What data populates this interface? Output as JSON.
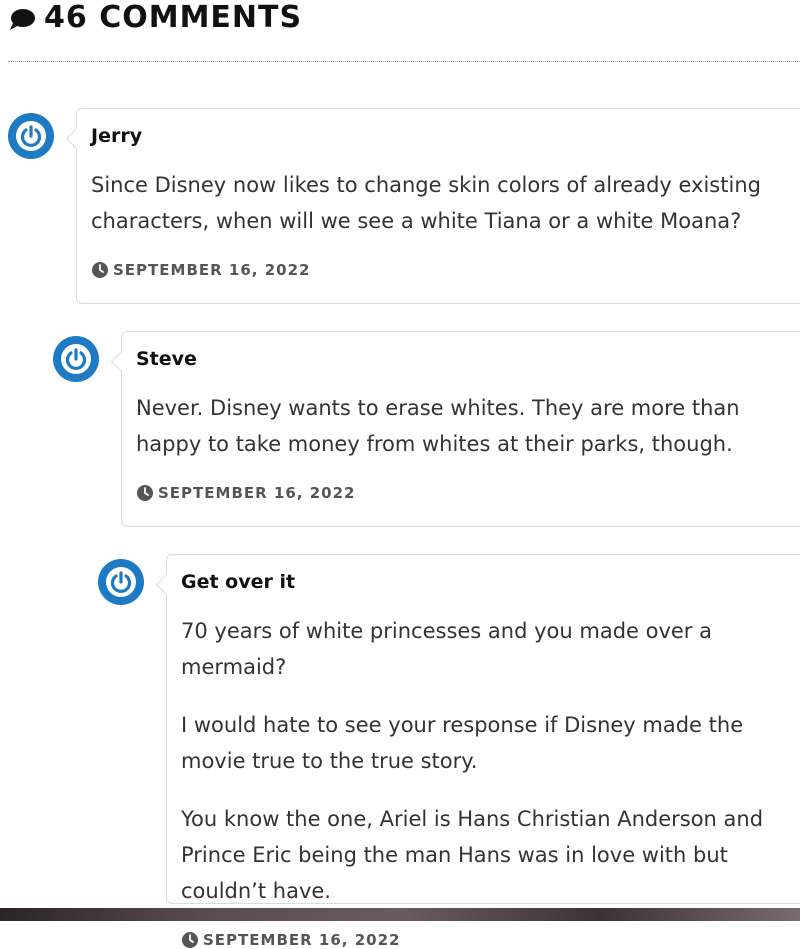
{
  "header": {
    "count_label": "46 COMMENTS",
    "icon": "speech-bubble-icon"
  },
  "comments": [
    {
      "author": "Jerry",
      "paragraphs": [
        "Since Disney now likes to change skin colors of already existing characters, when will we see a white Tiana or a white Moana?"
      ],
      "date": "SEPTEMBER 16, 2022",
      "avatar_icon": "power-icon"
    },
    {
      "author": "Steve",
      "paragraphs": [
        "Never. Disney wants to erase whites. They are more than happy to take money from whites at their parks, though."
      ],
      "date": "SEPTEMBER 16, 2022",
      "avatar_icon": "power-icon"
    },
    {
      "author": "Get over it",
      "paragraphs": [
        "70 years of white princesses and you made over a mermaid?",
        "I would hate to see your response if Disney made the movie true to the true story.",
        "You know the one, Ariel is Hans Christian Anderson and Prince Eric being the man Hans was in love with but couldn’t have."
      ],
      "date": "SEPTEMBER 16, 2022",
      "avatar_icon": "power-icon"
    }
  ],
  "colors": {
    "avatar": "#1e7ac2",
    "border": "#dcdcdc",
    "text": "#333333"
  }
}
